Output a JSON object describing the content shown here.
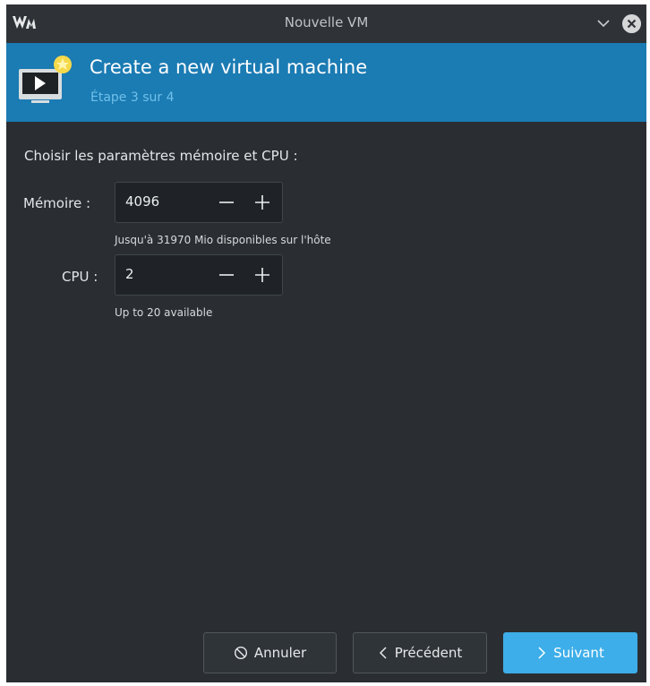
{
  "window": {
    "title": "Nouvelle VM",
    "icons": [
      "virt-manager-logo",
      "chevron-down-icon",
      "close-icon"
    ]
  },
  "header": {
    "title": "Create a new virtual machine",
    "step": "Étape 3 sur 4",
    "icon": "new-vm-icon"
  },
  "content": {
    "section_label": "Choisir les paramètres mémoire et CPU :",
    "memory": {
      "label": "Mémoire :",
      "value": "4096",
      "hint": "Jusqu'à 31970 Mio disponibles sur l'hôte"
    },
    "cpu": {
      "label": "CPU :",
      "value": "2",
      "hint": "Up to 20 available"
    }
  },
  "footer": {
    "cancel_label": "Annuler",
    "back_label": "Précédent",
    "next_label": "Suivant"
  },
  "colors": {
    "banner": "#1b7bb3",
    "window_bg": "#2a2e32",
    "primary": "#3daee9"
  }
}
